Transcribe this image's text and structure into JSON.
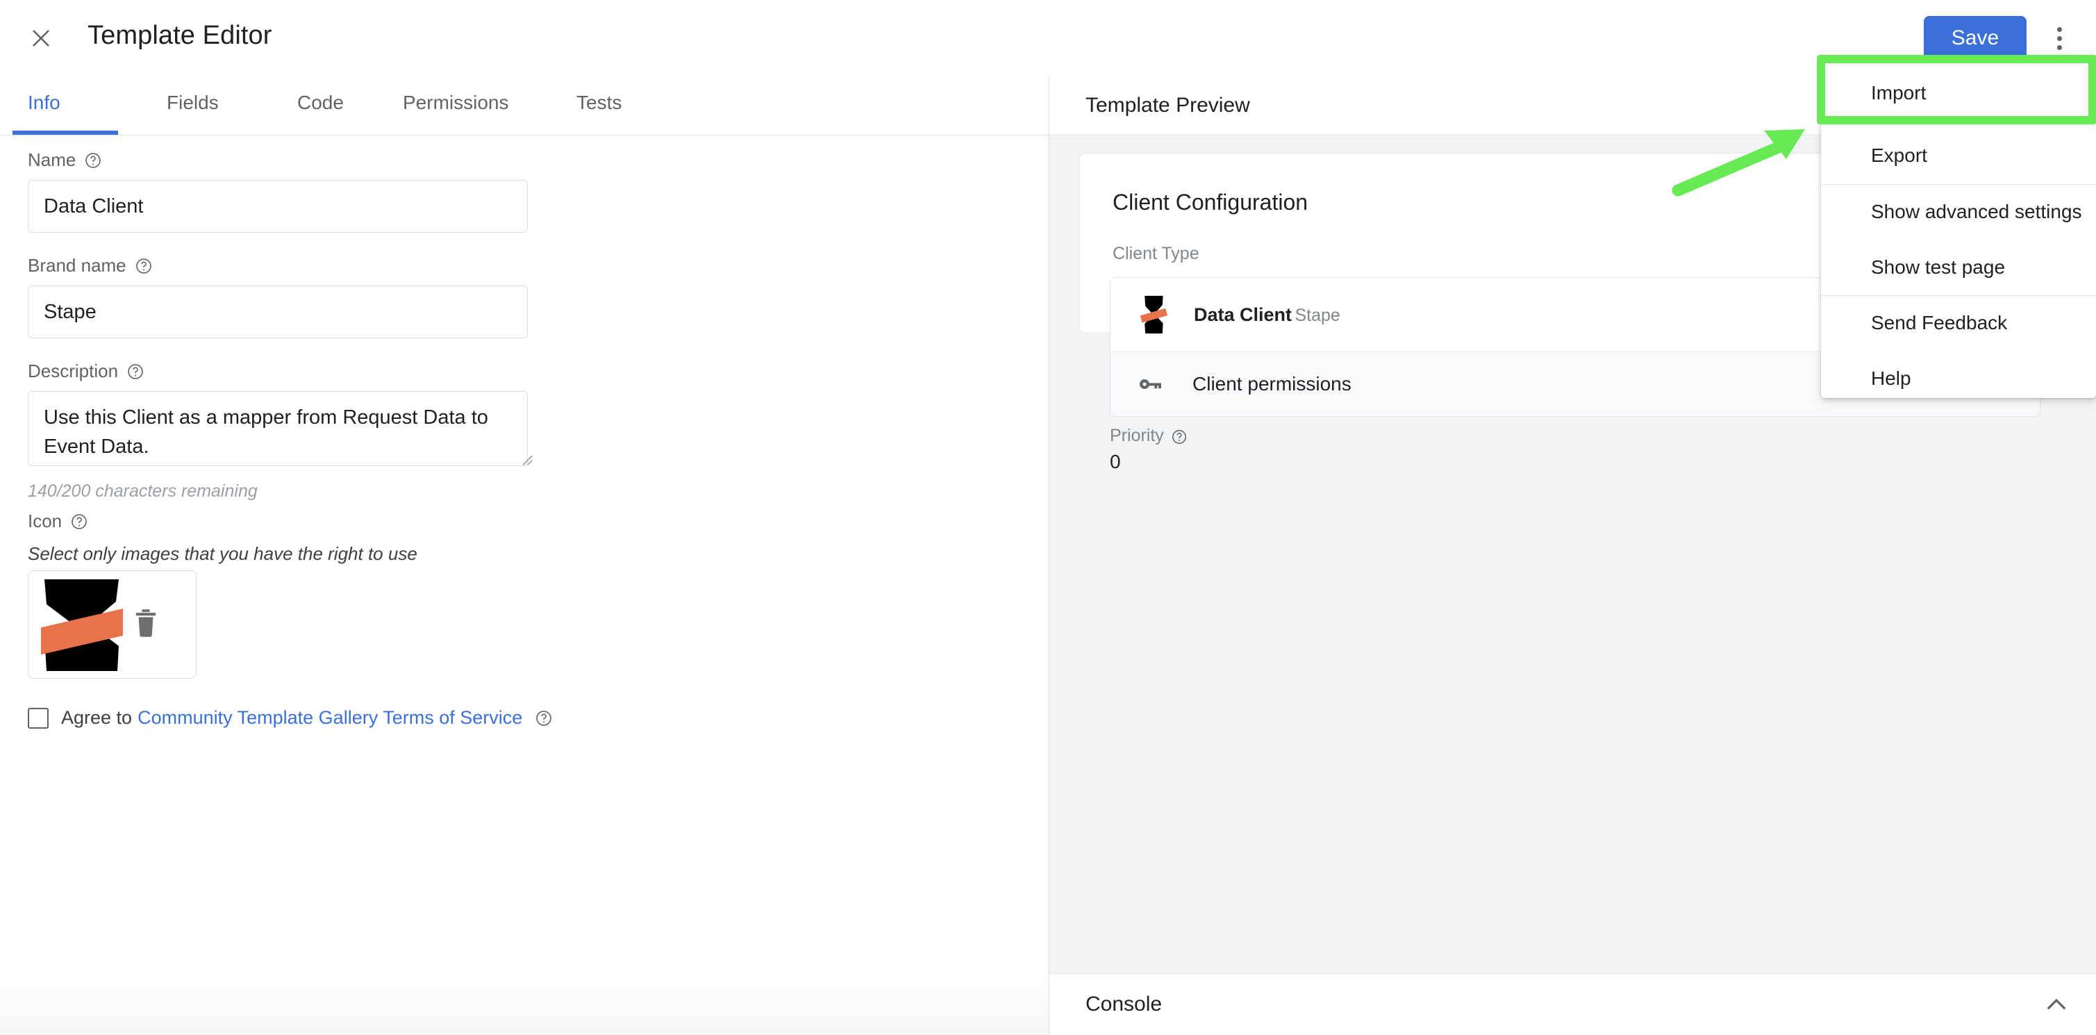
{
  "appbar": {
    "close_icon": "close-icon",
    "title": "Template Editor",
    "save_label": "Save",
    "kebab_icon": "more-vert-icon",
    "accent_color": "#3b70d8"
  },
  "tabs": [
    {
      "label": "Info",
      "active": true
    },
    {
      "label": "Fields",
      "active": false
    },
    {
      "label": "Code",
      "active": false
    },
    {
      "label": "Permissions",
      "active": false
    },
    {
      "label": "Tests",
      "active": false
    }
  ],
  "form": {
    "name": {
      "label": "Name",
      "help_icon": "help-circle-icon",
      "value": "Data Client"
    },
    "brand_name": {
      "label": "Brand name",
      "help_icon": "help-circle-icon",
      "value": "Stape"
    },
    "description": {
      "label": "Description",
      "help_icon": "help-circle-icon",
      "value": "Use this Client as a mapper from Request Data to Event Data.",
      "counter": "140/200 characters remaining",
      "resize_handle": "resize-grip-icon"
    },
    "icon": {
      "label": "Icon",
      "help_icon": "help-circle-icon",
      "note": "Select only images that you have the right to use",
      "thumbnail_name": "stape-logo-thumbnail",
      "delete_icon": "trash-icon",
      "logo_black": "#000000",
      "logo_orange": "#e8734a"
    },
    "terms": {
      "checkbox_name": "terms-checkbox",
      "checked": false,
      "prefix": "Agree to ",
      "link_text": "Community Template Gallery Terms of Service",
      "help_icon": "help-circle-icon",
      "link_color": "#3b70d8"
    }
  },
  "preview": {
    "header": "Template Preview",
    "card": {
      "title": "Client Configuration",
      "client_type_label": "Client Type",
      "rows": [
        {
          "icon": "stape-logo-icon",
          "name": "Data Client",
          "brand": "Stape"
        },
        {
          "icon": "key-icon",
          "label": "Client permissions"
        }
      ],
      "priority": {
        "label": "Priority",
        "help_icon": "help-circle-icon",
        "value": "0"
      }
    }
  },
  "console": {
    "label": "Console",
    "expand_icon": "chevron-up-icon"
  },
  "overflow_menu": {
    "items": [
      {
        "label": "Import",
        "separator_after": false,
        "highlighted": true
      },
      {
        "label": "Export",
        "separator_after": true,
        "highlighted": false
      },
      {
        "label": "Show advanced settings",
        "separator_after": false,
        "highlighted": false
      },
      {
        "label": "Show test page",
        "separator_after": true,
        "highlighted": false
      },
      {
        "label": "Send Feedback",
        "separator_after": false,
        "highlighted": false
      },
      {
        "label": "Help",
        "separator_after": false,
        "highlighted": false
      }
    ]
  },
  "annotation": {
    "color": "#66eb54",
    "highlight_target": "Import",
    "arrow_name": "annotation-arrow",
    "box_name": "annotation-highlight-box"
  }
}
